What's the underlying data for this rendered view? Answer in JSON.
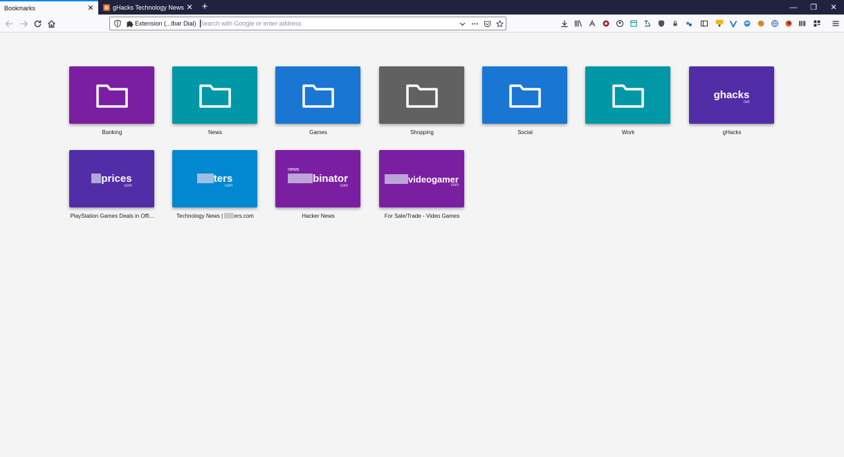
{
  "tabs": [
    {
      "title": "Bookmarks",
      "close": "✕"
    },
    {
      "title": "gHacks Technology News",
      "close": "✕"
    }
  ],
  "newtab_glyph": "+",
  "window_controls": {
    "minimize": "—",
    "restore": "❐",
    "close": "✕"
  },
  "urlbar": {
    "identity_label": "Extension (...lbar Dial)",
    "placeholder": "Search with Google or enter address",
    "value": ""
  },
  "icons": [
    "shield-icon",
    "puzzle-icon",
    "chevron-down-icon",
    "more-icon",
    "pocket-icon",
    "star-icon",
    "download-icon",
    "library-icon",
    "sync-icon",
    "menu-icon"
  ],
  "colors": {
    "purple": "#7b1fa2",
    "teal": "#0097a7",
    "blue": "#1976d2",
    "gray": "#616161",
    "indigo": "#512da8",
    "sky": "#0288d1",
    "accent": "#0a84ff"
  },
  "speed_dial": {
    "row1": [
      {
        "label": "Banking",
        "color": "#7b1fa2",
        "kind": "folder"
      },
      {
        "label": "News",
        "color": "#0097a7",
        "kind": "folder"
      },
      {
        "label": "Games",
        "color": "#1976d2",
        "kind": "folder"
      },
      {
        "label": "Shopping",
        "color": "#616161",
        "kind": "folder"
      },
      {
        "label": "Social",
        "color": "#1976d2",
        "kind": "folder"
      },
      {
        "label": "Work",
        "color": "#0097a7",
        "kind": "folder"
      },
      {
        "label": "gHacks",
        "color": "#512da8",
        "kind": "logo",
        "logo": "ghacks",
        "sub": "net"
      }
    ],
    "row2": [
      {
        "label": "PlayStation Games Deals in Offi...",
        "color": "#512da8",
        "kind": "logo",
        "logo": "prices",
        "sub": "com"
      },
      {
        "label_pre": "Technology News | ",
        "label_post": "ers.com",
        "color": "#0288d1",
        "kind": "logo",
        "logo": "ters",
        "sub": "com"
      },
      {
        "label": "Hacker News",
        "color": "#7b1fa2",
        "kind": "logo",
        "logo": "binator",
        "small": "news",
        "sub": "com"
      },
      {
        "label": "For Sale/Trade - Video Games",
        "color": "#7b1fa2",
        "kind": "logo",
        "logo": "videogamer",
        "sub": "com"
      }
    ]
  }
}
